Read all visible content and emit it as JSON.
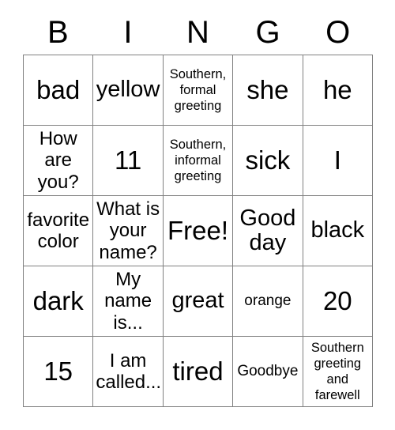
{
  "card": {
    "type": "bingo-card",
    "columns": 5,
    "rows": 5,
    "border_color": "#808080",
    "background_color": "#ffffff",
    "text_color": "#000000"
  },
  "header": {
    "letters": [
      "B",
      "I",
      "N",
      "G",
      "O"
    ]
  },
  "grid": {
    "rows": [
      [
        {
          "text": "bad",
          "size": "xl"
        },
        {
          "text": "yellow",
          "size": "lg"
        },
        {
          "text": "Southern,\nformal\ngreeting",
          "size": "xs"
        },
        {
          "text": "she",
          "size": "xl"
        },
        {
          "text": "he",
          "size": "xl"
        }
      ],
      [
        {
          "text": "How\nare\nyou?",
          "size": "md"
        },
        {
          "text": "11",
          "size": "xl"
        },
        {
          "text": "Southern,\ninformal\ngreeting",
          "size": "xs"
        },
        {
          "text": "sick",
          "size": "xl"
        },
        {
          "text": "I",
          "size": "xl"
        }
      ],
      [
        {
          "text": "favorite\ncolor",
          "size": "md"
        },
        {
          "text": "What is\nyour\nname?",
          "size": "md"
        },
        {
          "text": "Free!",
          "size": "xl"
        },
        {
          "text": "Good\nday",
          "size": "lg"
        },
        {
          "text": "black",
          "size": "lg"
        }
      ],
      [
        {
          "text": "dark",
          "size": "xl"
        },
        {
          "text": "My\nname\nis...",
          "size": "md"
        },
        {
          "text": "great",
          "size": "lg"
        },
        {
          "text": "orange",
          "size": "sm"
        },
        {
          "text": "20",
          "size": "xl"
        }
      ],
      [
        {
          "text": "15",
          "size": "xl"
        },
        {
          "text": "I am\ncalled...",
          "size": "md"
        },
        {
          "text": "tired",
          "size": "xl"
        },
        {
          "text": "Goodbye",
          "size": "sm"
        },
        {
          "text": "Southern\ngreeting\nand\nfarewell",
          "size": "xs"
        }
      ]
    ]
  }
}
